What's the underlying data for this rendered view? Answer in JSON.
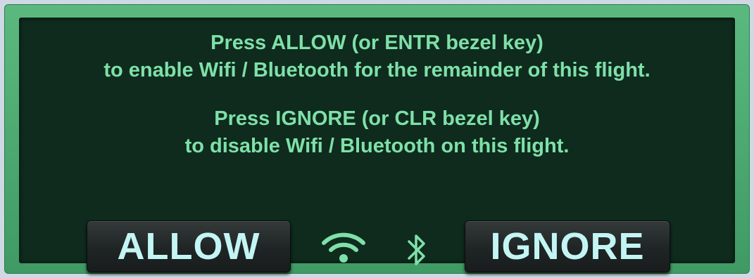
{
  "dialog": {
    "allow_message": {
      "line1": "Press ALLOW (or ENTR bezel key)",
      "line2": "to enable Wifi / Bluetooth for the remainder of this flight."
    },
    "ignore_message": {
      "line1": "Press IGNORE (or CLR bezel key)",
      "line2": "to disable Wifi / Bluetooth on this flight."
    },
    "buttons": {
      "allow_label": "ALLOW",
      "ignore_label": "IGNORE"
    },
    "icons": [
      "wifi-icon",
      "bluetooth-icon"
    ],
    "colors": {
      "frame": "#4fae74",
      "panel": "#0e2b1e",
      "text": "#7fe0a8",
      "button_text": "#c4f5f5",
      "button_bg": "#1f2424"
    }
  }
}
